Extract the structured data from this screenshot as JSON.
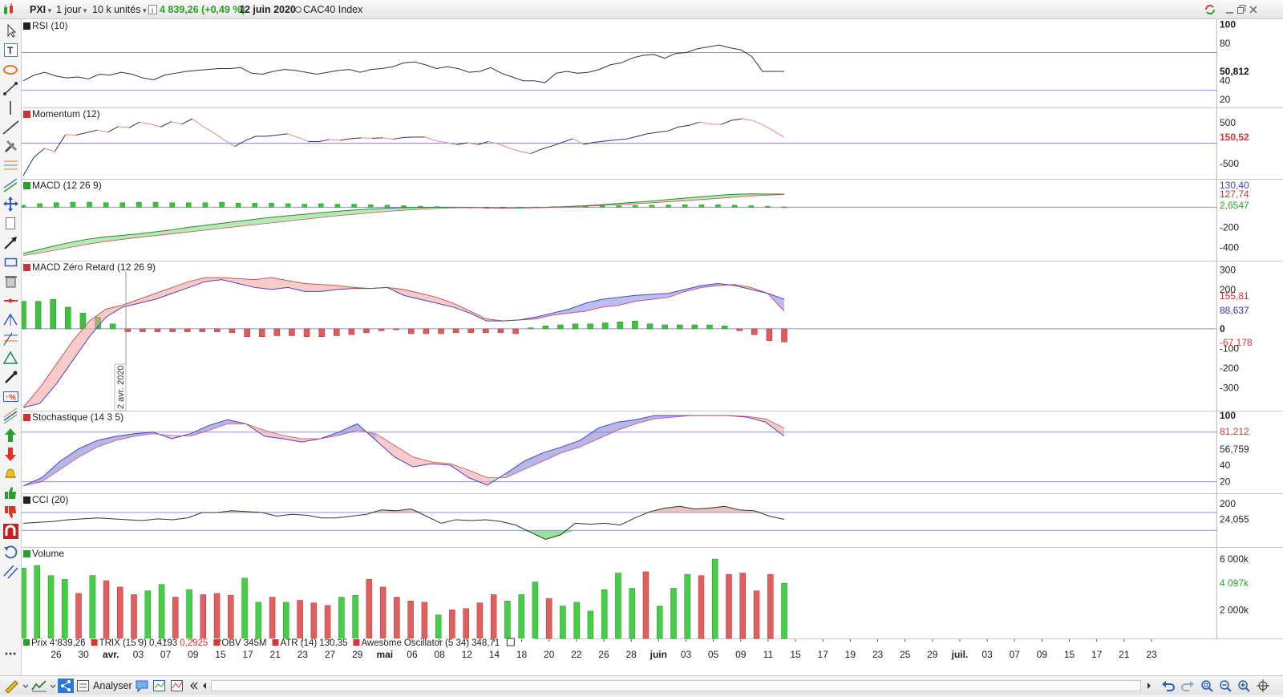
{
  "toolbar": {
    "symbol": "PXI",
    "period": "1 jour",
    "units": "10 k unités",
    "info_icon": "info-icon",
    "price_text": "4 839,26 (+0,49 %)",
    "date_text": "12 juin 2020",
    "index_name": "CAC40 Index",
    "colors": {
      "up": "#2aa02a"
    }
  },
  "bottom": {
    "analyser_label": "Analyser"
  },
  "legend_bottom": [
    {
      "name": "Prix",
      "value": "4 839,26",
      "color": "#000000"
    },
    {
      "name": "TRIX (15 9)",
      "value": "0,4193",
      "value2": "0,2925",
      "color": "#000000"
    },
    {
      "name": "OBV",
      "value": "345M",
      "color": "#000000"
    },
    {
      "name": "ATR (14)",
      "value": "130,35",
      "color": "#000000"
    },
    {
      "name": "Awesome Oscillator (5 34)",
      "value": "348,71",
      "color": "#c33"
    }
  ],
  "crosshair_label": "2 avr. 2020",
  "x_axis_labels": [
    "26",
    "30",
    "avr.",
    "03",
    "07",
    "09",
    "15",
    "17",
    "21",
    "23",
    "27",
    "29",
    "mai",
    "06",
    "08",
    "12",
    "14",
    "18",
    "20",
    "22",
    "26",
    "28",
    "juin",
    "03",
    "05",
    "09",
    "11",
    "15",
    "17",
    "19",
    "23",
    "25",
    "29",
    "juil.",
    "03",
    "07",
    "09",
    "15",
    "17",
    "21",
    "23"
  ],
  "chart_data": [
    {
      "type": "line",
      "title": "RSI (10)",
      "ylim": [
        15,
        102
      ],
      "ticks": [
        "100",
        "80",
        "40",
        "20"
      ],
      "ref_lines": [
        30,
        70
      ],
      "last_value": "50,812",
      "values": [
        40,
        46,
        49,
        45,
        43,
        44,
        42,
        47,
        46,
        49,
        47,
        43,
        41,
        46,
        48,
        50,
        51,
        52,
        53,
        53,
        54,
        48,
        47,
        50,
        52,
        51,
        49,
        47,
        49,
        51,
        52,
        49,
        52,
        53,
        55,
        59,
        60,
        57,
        53,
        55,
        53,
        49,
        50,
        54,
        48,
        44,
        40,
        40,
        38,
        48,
        50,
        48,
        49,
        52,
        57,
        59,
        64,
        67,
        68,
        64,
        69,
        70,
        74,
        76,
        78,
        75,
        73,
        66,
        50,
        50,
        50
      ]
    },
    {
      "type": "line",
      "title": "Momentum (12)",
      "ylim": [
        -800,
        800
      ],
      "ticks": [
        "500",
        "-500"
      ],
      "ref_lines": [
        0
      ],
      "last_value": "150,52",
      "values": [
        -800,
        -350,
        -130,
        -200,
        210,
        200,
        260,
        320,
        270,
        410,
        380,
        520,
        470,
        400,
        530,
        470,
        600,
        410,
        260,
        80,
        -80,
        60,
        170,
        170,
        200,
        230,
        140,
        40,
        40,
        90,
        70,
        110,
        130,
        120,
        130,
        100,
        140,
        150,
        150,
        60,
        20,
        -40,
        10,
        -40,
        40,
        -20,
        -120,
        -200,
        -260,
        -150,
        -70,
        20,
        110,
        -30,
        20,
        50,
        80,
        100,
        160,
        230,
        270,
        300,
        400,
        440,
        520,
        470,
        460,
        560,
        600,
        560,
        450,
        300,
        150
      ]
    },
    {
      "type": "line",
      "title": "MACD (12 26 9)",
      "ylim": [
        -500,
        250
      ],
      "ticks": [
        "-200",
        "-400"
      ],
      "last_values": [
        "130,40",
        "127,74",
        "2,6547"
      ],
      "macd": [
        -460,
        -420,
        -380,
        -345,
        -315,
        -295,
        -280,
        -265,
        -245,
        -225,
        -200,
        -180,
        -160,
        -140,
        -120,
        -100,
        -85,
        -70,
        -55,
        -40,
        -28,
        -18,
        -10,
        -5,
        -2,
        0,
        0,
        -2,
        -6,
        -10,
        -8,
        -4,
        2,
        8,
        16,
        26,
        38,
        50,
        62,
        76,
        90,
        104,
        118,
        128,
        132,
        131,
        130
      ],
      "signal": [
        -480,
        -455,
        -425,
        -395,
        -365,
        -340,
        -320,
        -300,
        -282,
        -264,
        -246,
        -228,
        -210,
        -192,
        -174,
        -156,
        -138,
        -120,
        -102,
        -84,
        -70,
        -56,
        -42,
        -30,
        -20,
        -12,
        -6,
        -4,
        -6,
        -8,
        -8,
        -6,
        -2,
        4,
        10,
        18,
        26,
        34,
        44,
        54,
        64,
        76,
        88,
        100,
        112,
        120,
        127
      ],
      "hist": [
        20,
        35,
        45,
        50,
        50,
        45,
        45,
        50,
        50,
        45,
        45,
        45,
        50,
        40,
        40,
        40,
        35,
        30,
        35,
        30,
        30,
        25,
        20,
        15,
        10,
        5,
        0,
        -5,
        -10,
        -5,
        0,
        2,
        5,
        8,
        10,
        12,
        15,
        18,
        20,
        22,
        25,
        25,
        25,
        20,
        15,
        10,
        3
      ]
    },
    {
      "type": "line",
      "title": "MACD Zéro Retard (12 26 9)",
      "ylim": [
        -400,
        330
      ],
      "ticks": [
        "300",
        "200",
        "0",
        "-100",
        "-200",
        "-300"
      ],
      "last_values": [
        "155,81",
        "88,637",
        "-67,178"
      ],
      "line_a": [
        -400,
        -300,
        -180,
        -60,
        40,
        100,
        120,
        150,
        180,
        210,
        240,
        260,
        260,
        255,
        250,
        260,
        245,
        230,
        225,
        220,
        210,
        205,
        210,
        200,
        180,
        160,
        130,
        90,
        50,
        40,
        45,
        50,
        70,
        80,
        90,
        110,
        120,
        140,
        150,
        160,
        190,
        210,
        220,
        225,
        210,
        180,
        90
      ],
      "line_b": [
        -400,
        -380,
        -280,
        -160,
        -40,
        60,
        110,
        130,
        150,
        180,
        210,
        240,
        250,
        230,
        210,
        200,
        210,
        190,
        190,
        200,
        205,
        205,
        210,
        170,
        150,
        130,
        110,
        80,
        40,
        40,
        45,
        60,
        80,
        100,
        130,
        150,
        160,
        170,
        175,
        180,
        200,
        220,
        230,
        220,
        200,
        180,
        150
      ],
      "hist": [
        140,
        140,
        150,
        110,
        80,
        60,
        25,
        -15,
        -15,
        -15,
        -15,
        -15,
        -15,
        -15,
        -20,
        -40,
        -40,
        -35,
        -35,
        -40,
        -40,
        -35,
        -30,
        -20,
        -10,
        -5,
        -25,
        -25,
        -25,
        -20,
        -20,
        -20,
        -20,
        -25,
        5,
        15,
        20,
        25,
        25,
        30,
        35,
        40,
        25,
        20,
        20,
        20,
        20,
        15,
        -10,
        -30,
        -60,
        -67
      ]
    },
    {
      "type": "area",
      "title": "Stochastique (14 3 5)",
      "ylim": [
        10,
        102
      ],
      "ticks": [
        "100",
        "40",
        "20"
      ],
      "ref_lines": [
        20,
        80
      ],
      "last_values": [
        "81,212",
        "56,759"
      ],
      "k": [
        15,
        25,
        45,
        60,
        70,
        75,
        78,
        80,
        72,
        78,
        88,
        95,
        90,
        75,
        72,
        68,
        72,
        80,
        90,
        70,
        50,
        38,
        42,
        40,
        25,
        16,
        30,
        45,
        55,
        62,
        70,
        85,
        92,
        95,
        100,
        100,
        100,
        100,
        100,
        98,
        92,
        75
      ],
      "d": [
        15,
        20,
        35,
        50,
        62,
        70,
        75,
        78,
        76,
        75,
        82,
        90,
        90,
        82,
        76,
        72,
        72,
        76,
        82,
        78,
        64,
        50,
        44,
        42,
        34,
        25,
        25,
        35,
        45,
        55,
        62,
        72,
        82,
        90,
        96,
        98,
        100,
        100,
        100,
        99,
        96,
        85
      ]
    },
    {
      "type": "line",
      "title": "CCI (20)",
      "ylim": [
        -250,
        280
      ],
      "ticks": [
        "200"
      ],
      "ref_lines": [
        100,
        -100
      ],
      "last_value": "24,055",
      "values": [
        -20,
        -10,
        0,
        20,
        30,
        40,
        30,
        20,
        10,
        30,
        20,
        40,
        100,
        100,
        120,
        110,
        100,
        60,
        80,
        70,
        40,
        40,
        60,
        80,
        130,
        120,
        140,
        60,
        -20,
        20,
        10,
        20,
        0,
        -40,
        -120,
        -200,
        -150,
        -20,
        -30,
        -20,
        -40,
        40,
        110,
        150,
        170,
        140,
        150,
        170,
        130,
        120,
        60,
        24
      ]
    },
    {
      "type": "bar",
      "title": "Volume",
      "ylim": [
        0,
        6700
      ],
      "ticks": [
        "6 000k",
        "2 000k"
      ],
      "last_value": "4 097k",
      "values": [
        5300,
        5500,
        4700,
        4400,
        3300,
        4700,
        4300,
        3800,
        3200,
        3500,
        4000,
        3000,
        3600,
        3200,
        3300,
        3150,
        4500,
        2600,
        3000,
        2600,
        2750,
        2550,
        2350,
        3000,
        3150,
        4400,
        3800,
        3000,
        2700,
        2600,
        1600,
        2000,
        2100,
        2550,
        3200,
        2700,
        3200,
        4200,
        2900,
        2300,
        2600,
        1900,
        3600,
        4900,
        3700,
        5000,
        2300,
        3700,
        4800,
        4700,
        6000,
        4800,
        4900,
        3500,
        4800,
        4097
      ],
      "up": [
        1,
        1,
        1,
        1,
        0,
        1,
        0,
        0,
        0,
        1,
        1,
        0,
        1,
        0,
        0,
        0,
        1,
        1,
        0,
        1,
        0,
        0,
        0,
        1,
        1,
        0,
        0,
        0,
        0,
        0,
        1,
        0,
        0,
        0,
        0,
        1,
        1,
        1,
        0,
        1,
        1,
        1,
        1,
        1,
        1,
        0,
        1,
        1,
        1,
        0,
        1,
        0,
        0,
        0,
        0,
        1
      ]
    }
  ]
}
